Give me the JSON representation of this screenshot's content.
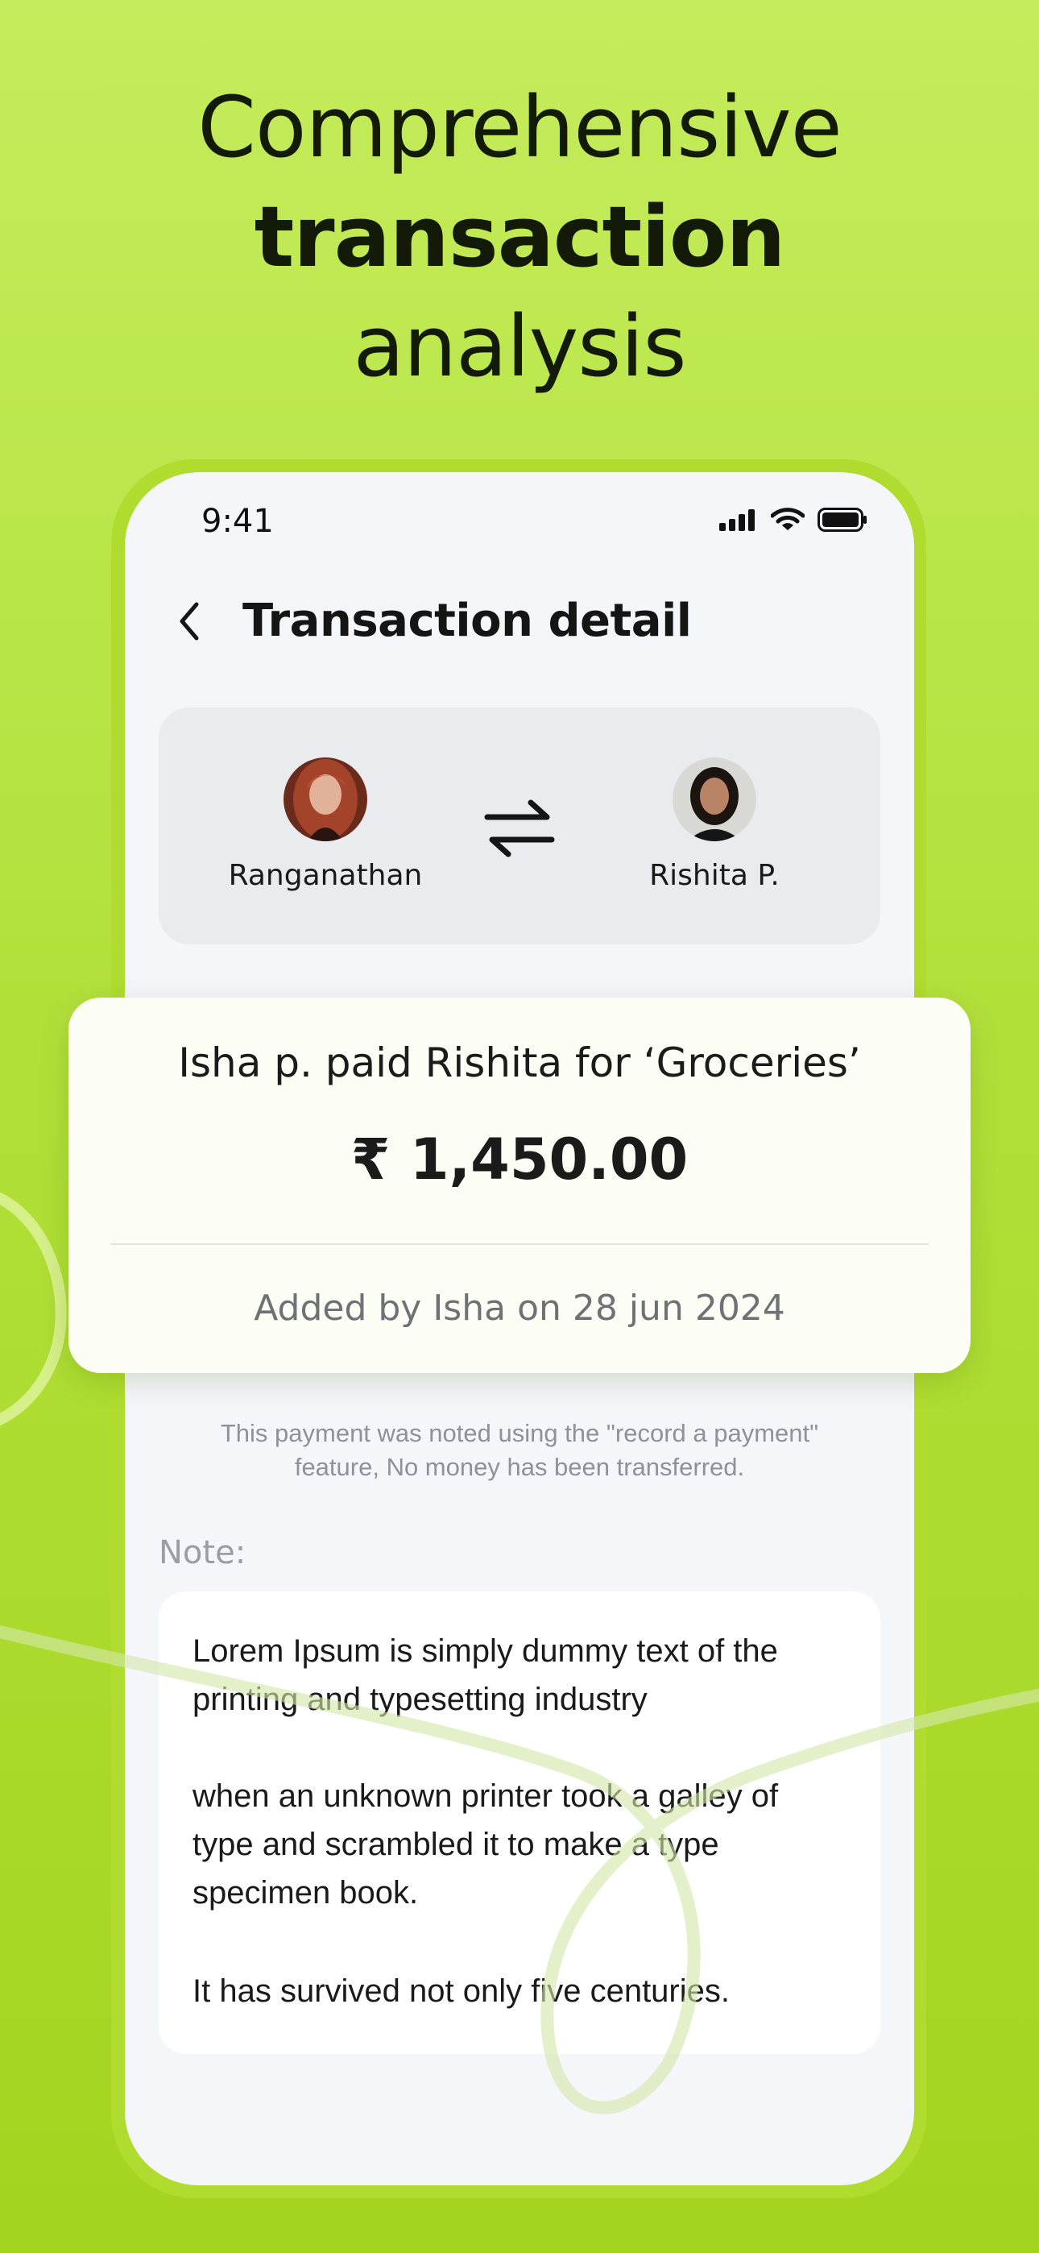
{
  "headline": {
    "line1": "Comprehensive",
    "line2": "transaction",
    "line3": "analysis"
  },
  "status_bar": {
    "time": "9:41",
    "icons": [
      "signal-icon",
      "wifi-icon",
      "battery-icon"
    ]
  },
  "nav": {
    "back_icon": "chevron-left-icon",
    "title": "Transaction detail"
  },
  "parties": {
    "from": {
      "name": "Ranganathan",
      "avatar": "avatar-red-hair"
    },
    "to": {
      "name": "Rishita P.",
      "avatar": "avatar-dark-hair"
    },
    "swap_icon": "swap-arrows-icon"
  },
  "summary": {
    "title": "Isha p. paid Rishita for ‘Groceries’",
    "amount": "₹ 1,450.00",
    "meta": "Added by Isha on 28 jun 2024"
  },
  "disclaimer": {
    "line1": "This payment was noted using the \"record a payment\"",
    "line2": "feature, No money has been transferred."
  },
  "note": {
    "label": "Note:",
    "paragraph1_line1": "Lorem Ipsum is simply dummy text of the",
    "paragraph1_line2": "printing and typesetting industry",
    "paragraph2_line1": "when an unknown printer took a galley of",
    "paragraph2_line2": "type and scrambled it to make a type",
    "paragraph2_line3": "specimen book.",
    "paragraph3": "It has survived not only five centuries."
  },
  "colors": {
    "background_top": "#c5ec5c",
    "background_bottom": "#a4d41f",
    "phone_border": "#b0dc30",
    "text_dark": "#141a08"
  }
}
